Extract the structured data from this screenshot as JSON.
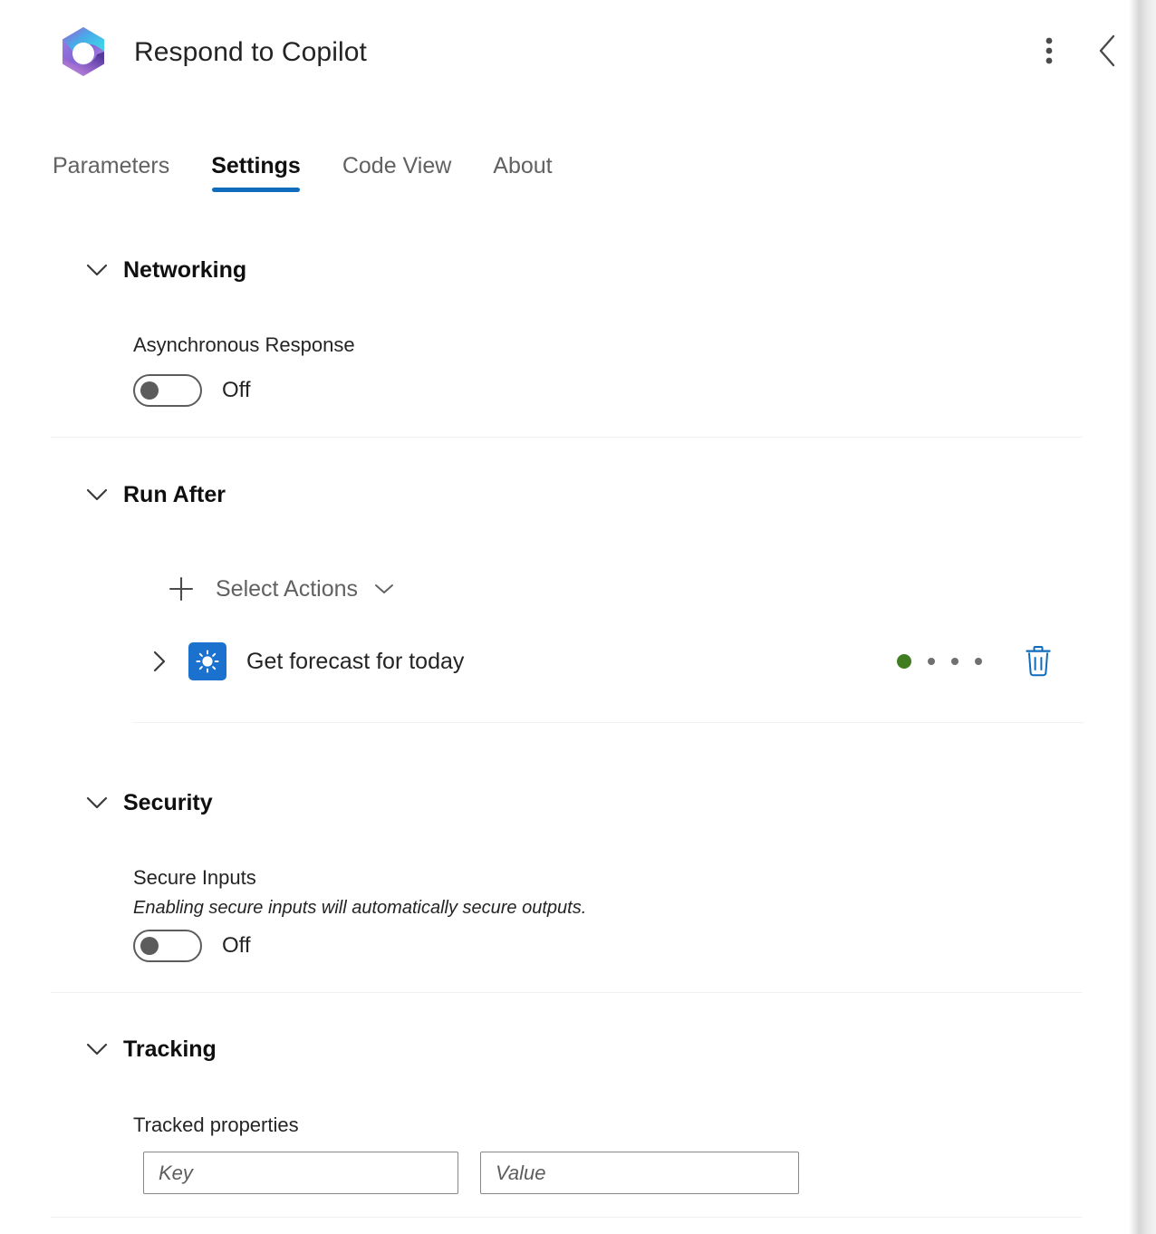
{
  "header": {
    "title": "Respond to Copilot",
    "logo_icon": "copilot-365-logo",
    "more_options_icon": "more-vertical-icon",
    "collapse_icon": "chevron-left-icon",
    "accent_color": "#0f6cbd"
  },
  "tabs": [
    {
      "label": "Parameters",
      "active": false
    },
    {
      "label": "Settings",
      "active": true
    },
    {
      "label": "Code View",
      "active": false
    },
    {
      "label": "About",
      "active": false
    }
  ],
  "sections": {
    "networking": {
      "title": "Networking",
      "chevron_icon": "chevron-down-icon",
      "async_response": {
        "label": "Asynchronous Response",
        "state": "Off"
      }
    },
    "run_after": {
      "title": "Run After",
      "chevron_icon": "chevron-down-icon",
      "select_actions": {
        "label": "Select Actions",
        "plus_icon": "plus-icon",
        "chevron_icon": "chevron-down-icon"
      },
      "action": {
        "name": "Get forecast for today",
        "expand_icon": "chevron-right-icon",
        "connector_icon": "weather-sun-icon",
        "connector_color": "#1b72ce",
        "status_dot_color": "#3f7d20",
        "status_dots_inactive": 3,
        "delete_icon": "trash-icon",
        "delete_color": "#0f6cbd"
      }
    },
    "security": {
      "title": "Security",
      "chevron_icon": "chevron-down-icon",
      "secure_inputs": {
        "label": "Secure Inputs",
        "hint": "Enabling secure inputs will automatically secure outputs.",
        "state": "Off"
      }
    },
    "tracking": {
      "title": "Tracking",
      "chevron_icon": "chevron-down-icon",
      "tracked_properties": {
        "label": "Tracked properties",
        "key_placeholder": "Key",
        "key_value": "",
        "value_placeholder": "Value",
        "value_value": ""
      }
    }
  }
}
